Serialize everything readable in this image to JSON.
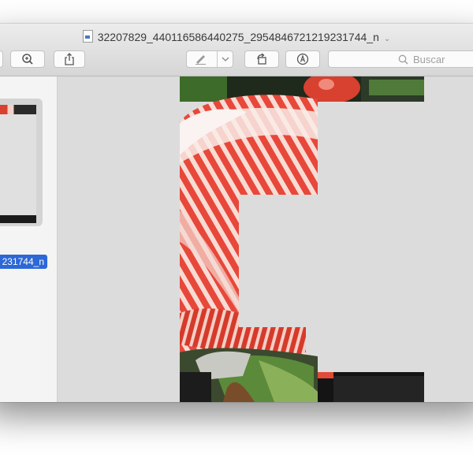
{
  "window": {
    "title": "32207829_440116586440275_2954846721219231744_n",
    "title_chevron": "⌄"
  },
  "toolbar": {
    "zoom_icon": "zoom-in-icon",
    "share_icon": "share-icon",
    "markup_icon": "pen-icon",
    "markup_dropdown_icon": "chevron-down-icon",
    "rotate_icon": "rotate-icon",
    "annotate_icon": "annotate-icon",
    "search_placeholder": "Buscar"
  },
  "sidebar": {
    "items": [
      {
        "label": "231744_n",
        "selected": true
      }
    ]
  },
  "colors": {
    "selection": "#2c68d6",
    "petal_red": "#d8402f",
    "petal_white": "#f6e9e6",
    "leaf_green": "#3c6b2a",
    "background_gray": "#dcdcdc"
  }
}
